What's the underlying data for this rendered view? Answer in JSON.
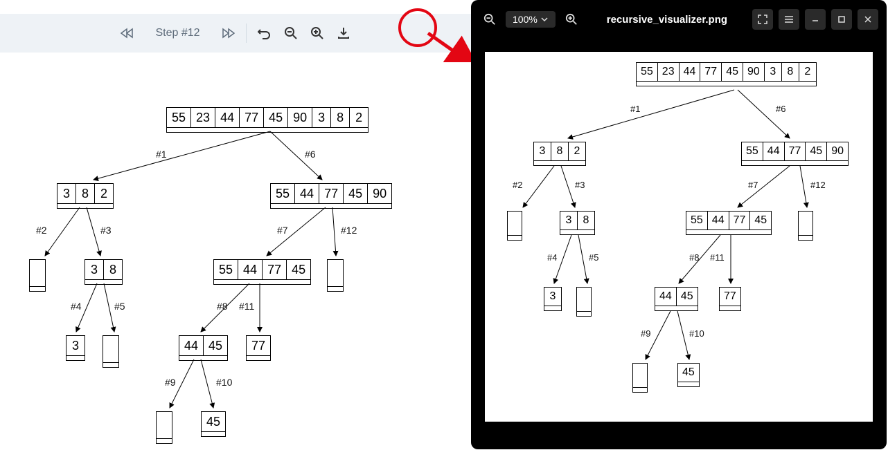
{
  "toolbar": {
    "step_label": "Step #12"
  },
  "viewer": {
    "zoom_label": "100%",
    "filename": "recursive_visualizer.png"
  },
  "tree": {
    "rows": [
      {
        "cells": [
          "55",
          "23",
          "44",
          "77",
          "45",
          "90",
          "3",
          "8",
          "2"
        ]
      },
      {
        "cells": [
          "3",
          "8",
          "2"
        ]
      },
      {
        "cells": [
          "55",
          "44",
          "77",
          "45",
          "90"
        ]
      },
      {
        "cells": [
          "3",
          "8"
        ]
      },
      {
        "cells": [
          "55",
          "44",
          "77",
          "45"
        ]
      },
      {
        "cells": [
          "3"
        ]
      },
      {
        "cells": [
          "44",
          "45"
        ]
      },
      {
        "cells": [
          "77"
        ]
      },
      {
        "cells": [
          "45"
        ]
      }
    ],
    "labels": {
      "l1": "#1",
      "l6": "#6",
      "l2": "#2",
      "l3": "#3",
      "l7": "#7",
      "l12": "#12",
      "l4": "#4",
      "l5": "#5",
      "l8": "#8",
      "l11": "#11",
      "l9": "#9",
      "l10": "#10"
    }
  }
}
